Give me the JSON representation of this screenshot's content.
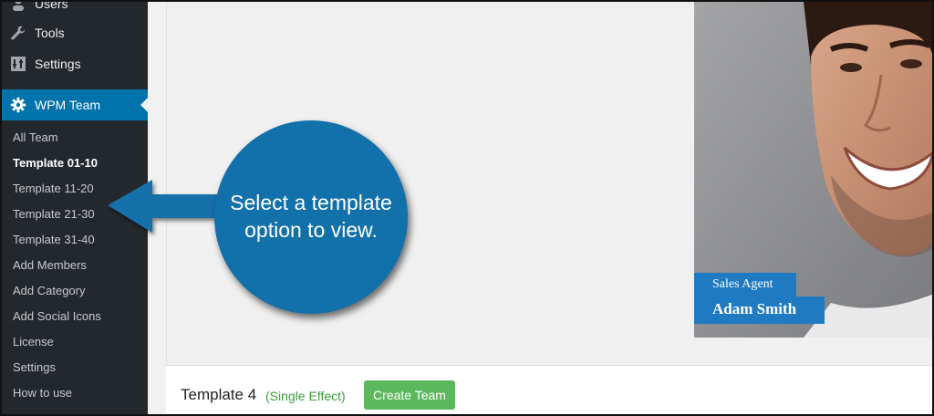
{
  "sidebar": {
    "menu": [
      {
        "label": "Users",
        "icon": "users-icon"
      },
      {
        "label": "Tools",
        "icon": "wrench-icon"
      },
      {
        "label": "Settings",
        "icon": "settings-icon"
      },
      {
        "label": "WPM Team",
        "icon": "gear-icon",
        "active": true
      }
    ],
    "submenu": [
      "All Team",
      "Template 01-10",
      "Template 11-20",
      "Template 21-30",
      "Template 31-40",
      "Add Members",
      "Add Category",
      "Add Social Icons",
      "License",
      "Settings",
      "How to use"
    ],
    "current_submenu_index": 1
  },
  "preview": {
    "role": "Sales Agent",
    "name": "Adam Smith"
  },
  "template_bar": {
    "name": "Template 4",
    "effect": "(Single Effect)",
    "create_button": "Create Team"
  },
  "callout": {
    "line1": "Select a template",
    "line2": "option to view."
  },
  "colors": {
    "sidebar_bg": "#23282d",
    "active_blue": "#0073aa",
    "callout_blue": "#1270aa",
    "caption_blue": "#1f7ac2",
    "button_green": "#5cb85c"
  }
}
